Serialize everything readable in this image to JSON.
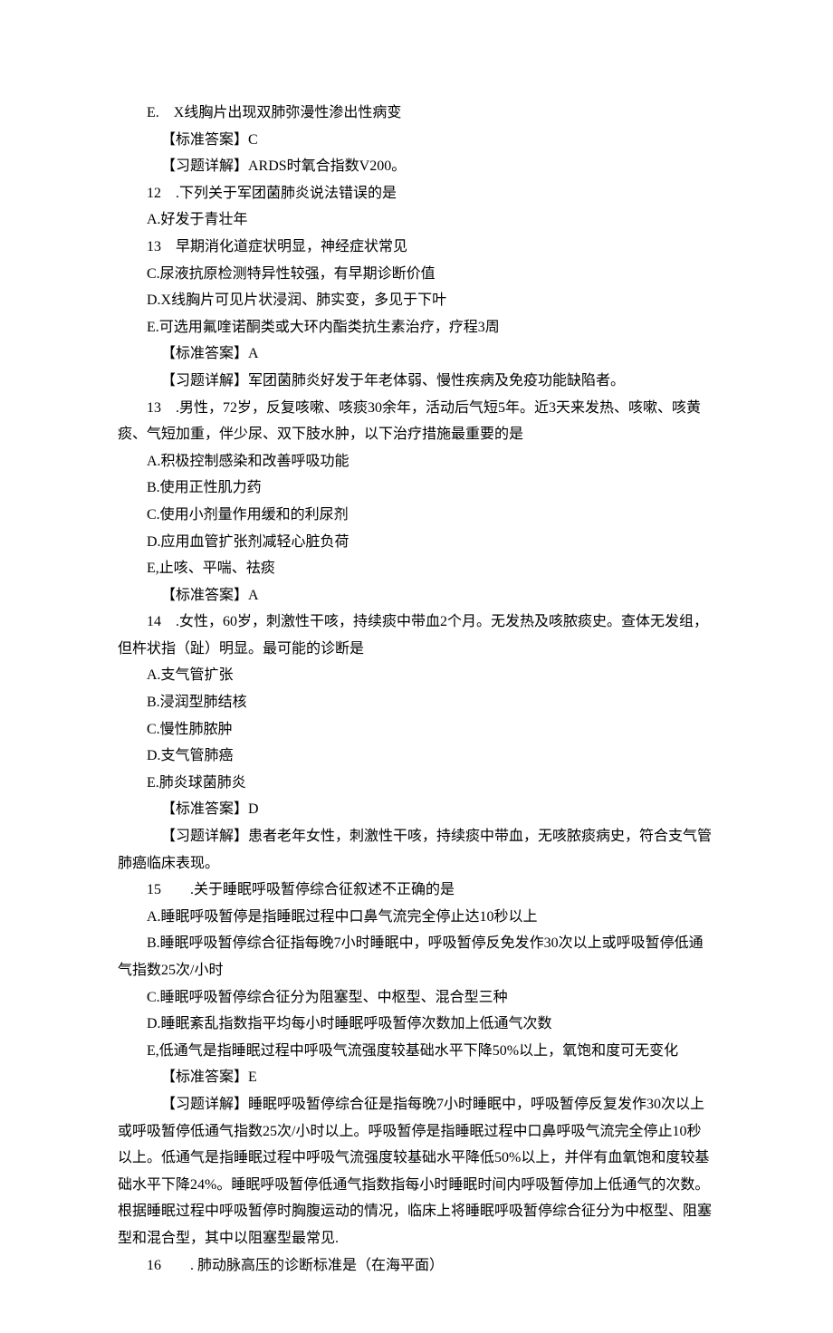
{
  "q11": {
    "optE": "E. X线胸片出现双肺弥漫性渗出性病变",
    "ansLabel": "【标准答案】C",
    "expl": "【习题详解】ARDS时氧合指数V200。"
  },
  "q12": {
    "stem": "12 .下列关于军团菌肺炎说法错误的是",
    "optA": "A.好发于青壮年",
    "optB": "13 早期消化道症状明显，神经症状常见",
    "optC": "C.尿液抗原检测特异性较强，有早期诊断价值",
    "optD": "D.X线胸片可见片状浸润、肺实变，多见于下叶",
    "optE": "E.可选用氟喹诺酮类或大环内酯类抗生素治疗，疗程3周",
    "ansLabel": "【标准答案】A",
    "expl": "【习题详解】军团菌肺炎好发于年老体弱、慢性疾病及免疫功能缺陷者。"
  },
  "q13": {
    "stem": "13 .男性，72岁，反复咳嗽、咳痰30余年，活动后气短5年。近3天来发热、咳嗽、咳黄痰、气短加重，伴少尿、双下肢水肿，以下治疗措施最重要的是",
    "optA": "A.积极控制感染和改善呼吸功能",
    "optB": "B.使用正性肌力药",
    "optC": "C.使用小剂量作用缓和的利尿剂",
    "optD": "D.应用血管扩张剂减轻心脏负荷",
    "optE": "E,止咳、平喘、祛痰",
    "ansLabel": "【标准答案】A"
  },
  "q14": {
    "stem": "14 .女性，60岁，刺激性干咳，持续痰中带血2个月。无发热及咳脓痰史。查体无发组，但杵状指（趾）明显。最可能的诊断是",
    "optA": "A.支气管扩张",
    "optB": "B.浸润型肺结核",
    "optC": "C.慢性肺脓肿",
    "optD": "D.支气管肺癌",
    "optE": "E.肺炎球菌肺炎",
    "ansLabel": "【标准答案】D",
    "expl": "【习题详解】患者老年女性，刺激性干咳，持续痰中带血，无咳脓痰病史，符合支气管肺癌临床表现。"
  },
  "q15": {
    "stem": "15  .关于睡眠呼吸暂停综合征叙述不正确的是",
    "optA": "A.睡眠呼吸暂停是指睡眠过程中口鼻气流完全停止达10秒以上",
    "optB": "B.睡眠呼吸暂停综合征指每晚7小时睡眠中，呼吸暂停反免发作30次以上或呼吸暂停低通气指数25次/小时",
    "optC": "C.睡眠呼吸暂停综合征分为阻塞型、中枢型、混合型三种",
    "optD": "D.睡眠紊乱指数指平均每小时睡眠呼吸暂停次数加上低通气次数",
    "optE": "E,低通气是指睡眠过程中呼吸气流强度较基础水平下降50%以上，氧饱和度可无变化",
    "ansLabel": "【标准答案】E",
    "expl": "【习题详解】睡眠呼吸暂停综合征是指每晚7小时睡眠中，呼吸暂停反复发作30次以上或呼吸暂停低通气指数25次/小时以上。呼吸暂停是指睡眠过程中口鼻呼吸气流完全停止10秒以上。低通气是指睡眠过程中呼吸气流强度较基础水平降低50%以上，并伴有血氧饱和度较基础水平下降24%。睡眠呼吸暂停低通气指数指每小时睡眠时间内呼吸暂停加上低通气的次数。根据睡眠过程中呼吸暂停时胸腹运动的情况，临床上将睡眠呼吸暂停综合征分为中枢型、阻塞型和混合型，其中以阻塞型最常见."
  },
  "q16": {
    "stem": "16  . 肺动脉高压的诊断标准是（在海平面）"
  }
}
